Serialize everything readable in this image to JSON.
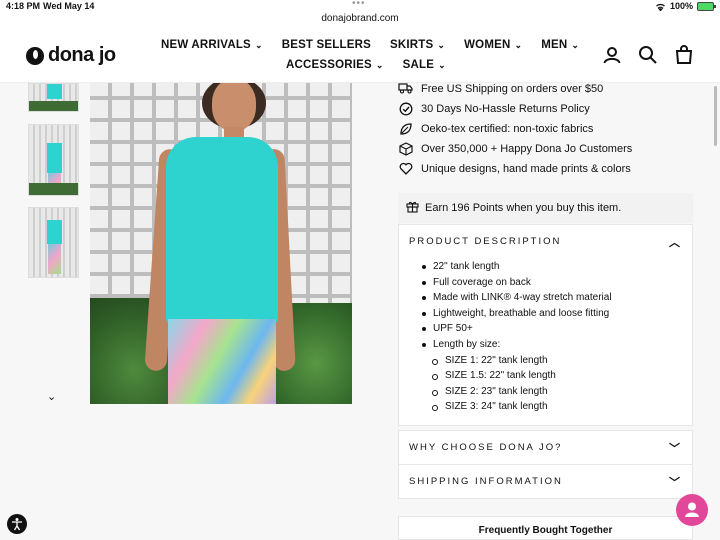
{
  "status_bar": {
    "time": "4:18 PM",
    "date": "Wed May 14",
    "battery": "100%"
  },
  "browser": {
    "url": "donajobrand.com"
  },
  "header": {
    "logo": "dona jo",
    "nav_row1": [
      "NEW ARRIVALS",
      "BEST SELLERS",
      "SKIRTS",
      "WOMEN",
      "MEN"
    ],
    "nav_row2": [
      "ACCESSORIES",
      "SALE"
    ],
    "icons": [
      "account-icon",
      "search-icon",
      "cart-icon"
    ]
  },
  "features": [
    {
      "icon": "truck-icon",
      "text": "Free US Shipping on orders over $50"
    },
    {
      "icon": "check-circle-icon",
      "text": "30 Days No-Hassle Returns Policy"
    },
    {
      "icon": "leaf-icon",
      "text": "Oeko-tex certified: non-toxic fabrics"
    },
    {
      "icon": "box-icon",
      "text": "Over 350,000 + Happy Dona Jo Customers"
    },
    {
      "icon": "heart-icon",
      "text": "Unique designs, hand made prints & colors"
    }
  ],
  "points": {
    "icon": "gift-icon",
    "text": "Earn 196 Points when you buy this item."
  },
  "product_description": {
    "title": "PRODUCT DESCRIPTION",
    "items": [
      "22\" tank length",
      "Full coverage on back",
      "Made with LINK® 4-way stretch material",
      "Lightweight, breathable and loose fitting",
      "UPF 50+",
      "Length by size:"
    ],
    "sizes": [
      "SIZE 1:  22\" tank length",
      "SIZE 1.5: 22\" tank length",
      "SIZE 2: 23\" tank length",
      "SIZE 3: 24\" tank length"
    ]
  },
  "why_choose": {
    "title": "WHY CHOOSE DONA JO?"
  },
  "shipping": {
    "title": "SHIPPING INFORMATION"
  },
  "frequently_bought": {
    "title": "Frequently Bought Together"
  },
  "colors": {
    "accent_pink": "#e2489a",
    "tank_turquoise": "#2ed3d0"
  }
}
